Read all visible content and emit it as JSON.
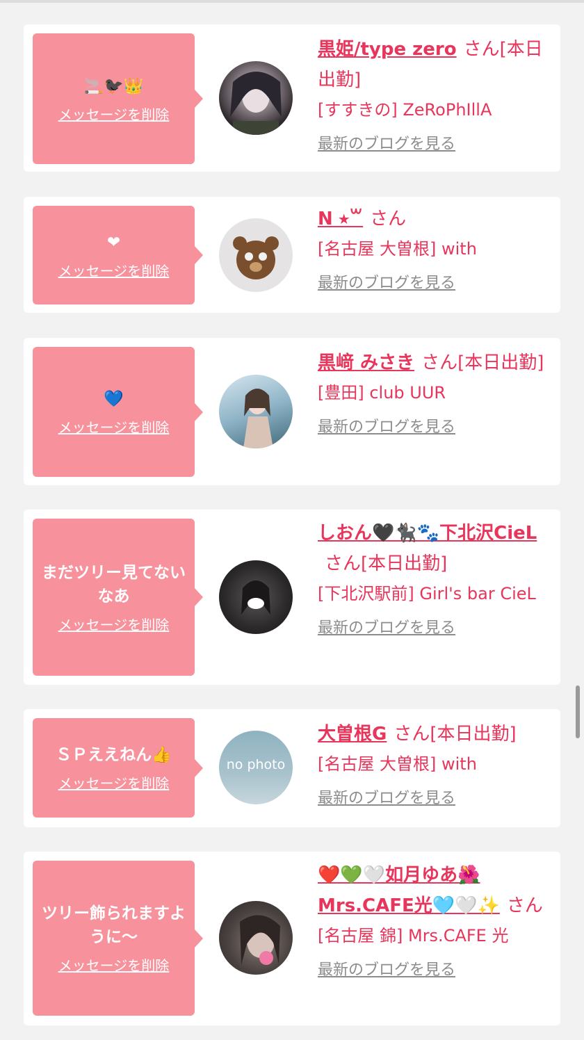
{
  "delete_label": "メッセージを削除",
  "blog_label": "最新のブログを見る",
  "san_label": "さん",
  "cards": [
    {
      "message": "🚬🐦‍⬛👑",
      "name": "黒姫/type zero",
      "status": "[本日出勤]",
      "shop": "[すすきの] ZeRoPhIllA",
      "avatar_icon": "avatar-photo-dark-hair"
    },
    {
      "message": "❤",
      "name": "N ⭑꒳",
      "status": "",
      "shop": "[名古屋 大曽根] with",
      "avatar_icon": "avatar-teddy-bear"
    },
    {
      "message": "💙",
      "name": "黒﨑 みさき",
      "status": "[本日出勤]",
      "shop": "[豊田] club UUR",
      "avatar_icon": "avatar-photo-dress"
    },
    {
      "message": "まだツリー見てないなあ",
      "name": "しおん🖤🐈‍⬛🐾下北沢CieL",
      "status": "[本日出勤]",
      "shop": "[下北沢駅前] Girl's bar CieL",
      "avatar_icon": "avatar-photo-dark"
    },
    {
      "message": "ＳＰええねん👍",
      "name": "大曽根G",
      "status": "[本日出勤]",
      "shop": "[名古屋 大曽根] with",
      "avatar_icon": "avatar-no-photo",
      "avatar_text": "no photo"
    },
    {
      "message": "ツリー飾られますように〜",
      "name": "❤️💚🤍如月ゆあ🌺Mrs.CAFE光🩵🤍✨",
      "status": "",
      "shop": "[名古屋 錦] Mrs.CAFE 光",
      "avatar_icon": "avatar-photo-face"
    }
  ]
}
